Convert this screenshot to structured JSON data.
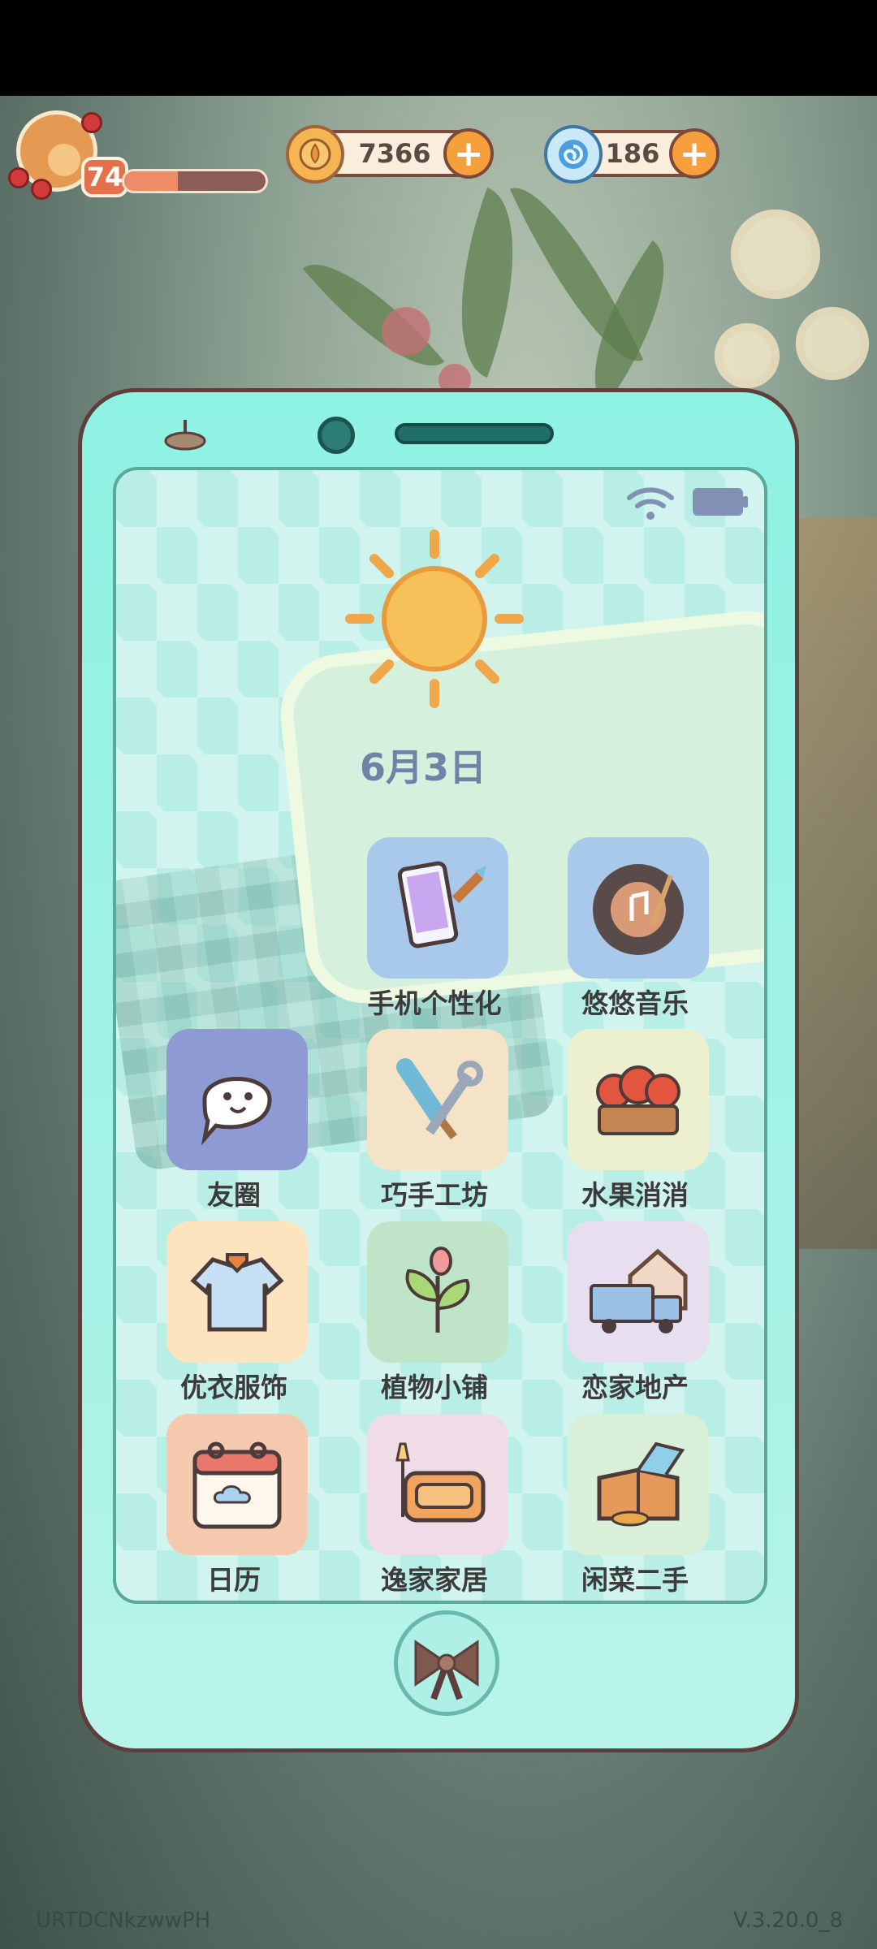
{
  "hud": {
    "level": "74",
    "xp_progress": 0.38,
    "coins": "7366",
    "gems": "186",
    "coin_icon": "flower-coin-icon",
    "gem_icon": "spiral-gem-icon"
  },
  "phone": {
    "date": "6月3日",
    "apps": [
      {
        "label": "手机个性化",
        "icon": "phone-paint-icon",
        "color": "#a8c9e9"
      },
      {
        "label": "悠悠音乐",
        "icon": "record-player-icon",
        "color": "#a8c9e9"
      },
      {
        "label": "友圈",
        "icon": "chat-bubble-icon",
        "color": "#8e9ad3"
      },
      {
        "label": "巧手工坊",
        "icon": "tools-icon",
        "color": "#f4e3c6"
      },
      {
        "label": "水果消消",
        "icon": "apple-basket-icon",
        "color": "#edf0cf"
      },
      {
        "label": "优衣服饰",
        "icon": "shirt-icon",
        "color": "#fce4bf"
      },
      {
        "label": "植物小铺",
        "icon": "sprout-icon",
        "color": "#bfe4c8"
      },
      {
        "label": "恋家地产",
        "icon": "moving-truck-icon",
        "color": "#e7dff0"
      },
      {
        "label": "日历",
        "icon": "calendar-icon",
        "color": "#f5c9ad"
      },
      {
        "label": "逸家家居",
        "icon": "sofa-icon",
        "color": "#f0dce6"
      },
      {
        "label": "闲菜二手",
        "icon": "box-tag-icon",
        "color": "#d9efd7"
      }
    ]
  },
  "footer": {
    "player_id": "URTDCNkzwwPH",
    "version": "V.3.20.0_8"
  }
}
